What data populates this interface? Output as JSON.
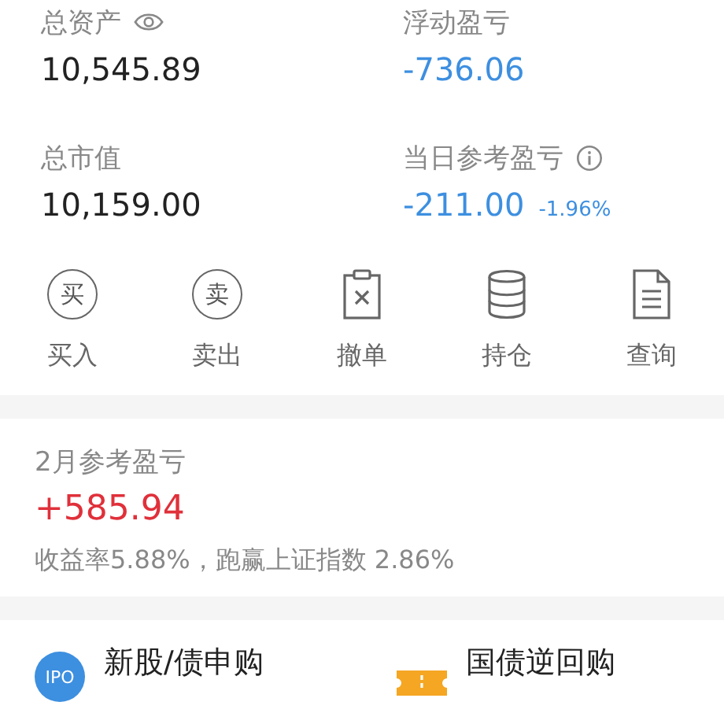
{
  "stats": [
    {
      "label": "总资产",
      "kind": "eye",
      "value": "10,545.89",
      "color": "#222222"
    },
    {
      "label": "浮动盈亏",
      "kind": "plain",
      "value": "-736.06",
      "color": "#3d8fe0"
    },
    {
      "label": "总市值",
      "kind": "plain",
      "value": "10,159.00",
      "color": "#222222"
    },
    {
      "label": "当日参考盈亏",
      "kind": "info",
      "value": "-211.00",
      "change": "-1.96%",
      "color": "#3d8fe0"
    }
  ],
  "actions": [
    {
      "label": "买入",
      "kind": "glyph",
      "glyph": "买"
    },
    {
      "label": "卖出",
      "kind": "glyph",
      "glyph": "卖"
    },
    {
      "label": "撤单",
      "kind": "cancel"
    },
    {
      "label": "持仓",
      "kind": "stack"
    },
    {
      "label": "查询",
      "kind": "document"
    }
  ],
  "monthly": {
    "title": "2月参考盈亏",
    "value": "+585.94",
    "color": "#e0303a",
    "summary": "收益率5.88%，跑赢上证指数 2.86%"
  },
  "services": [
    {
      "label": "新股/债申购",
      "kind": "badge",
      "badge": "IPO"
    },
    {
      "label": "国债逆回购",
      "kind": "ticket"
    }
  ]
}
